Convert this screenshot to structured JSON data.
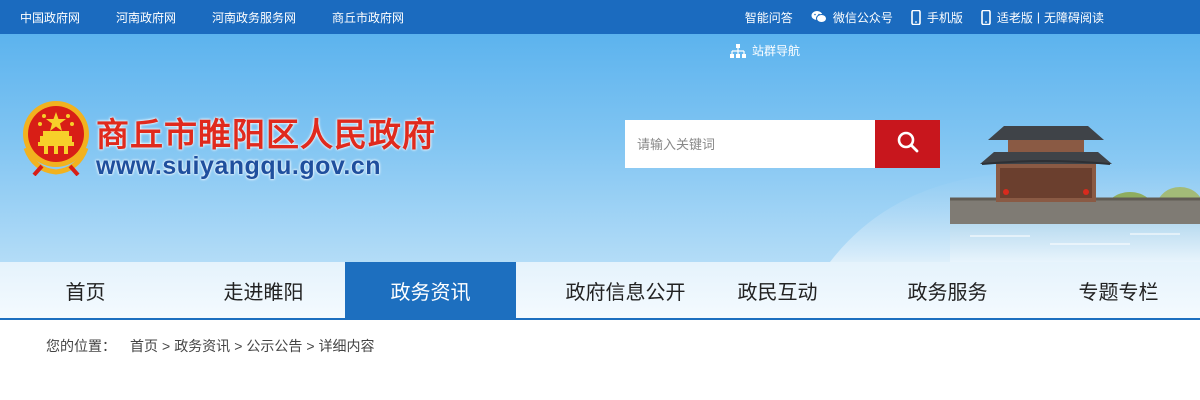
{
  "topbar": {
    "left_links": [
      "中国政府网",
      "河南政府网",
      "河南政务服务网",
      "商丘市政府网"
    ],
    "right": {
      "smart_qa": "智能问答",
      "wechat": "微信公众号",
      "mobile": "手机版",
      "elderly": "适老版",
      "separator": "|",
      "accessible": "无障碍阅读"
    }
  },
  "header": {
    "site_nav": "站群导航",
    "title": "商丘市睢阳区人民政府",
    "url": "www.suiyangqu.gov.cn",
    "search_placeholder": "请输入关键词"
  },
  "nav": {
    "items": [
      "首页",
      "走进睢阳",
      "政务资讯",
      "政府信息公开",
      "政民互动",
      "政务服务",
      "专题专栏"
    ],
    "active_index": 2
  },
  "breadcrumb": {
    "prefix": "您的位置：",
    "items": [
      "首页",
      "政务资讯",
      "公示公告",
      "详细内容"
    ],
    "separator": ">"
  },
  "colors": {
    "topbar_bg": "#1b6bbf",
    "accent_blue": "#1d6fbf",
    "search_button": "#c8161d",
    "title_red": "#e02a1d",
    "url_blue": "#1f4f9e"
  }
}
